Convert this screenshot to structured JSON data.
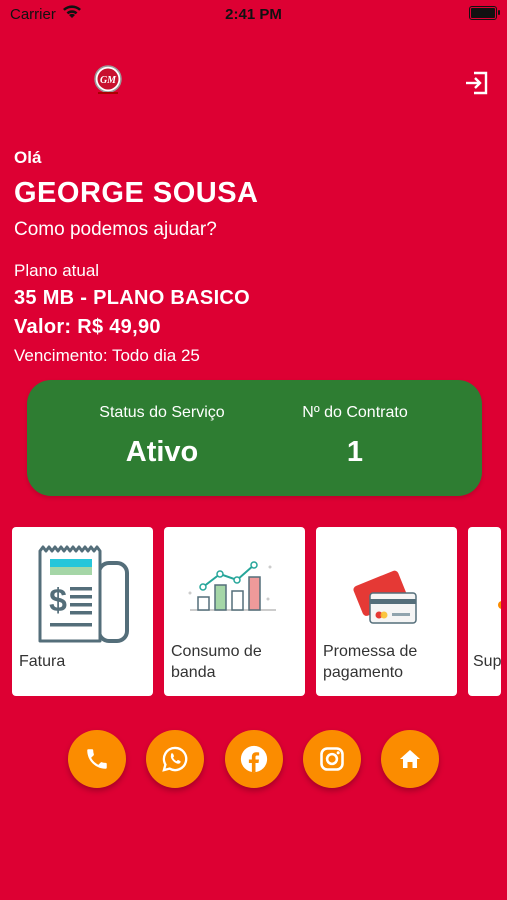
{
  "status_bar": {
    "carrier": "Carrier",
    "time": "2:41 PM"
  },
  "header": {
    "logo_text": "GM",
    "logout_icon": "logout-icon"
  },
  "greeting": {
    "hello": "Olá",
    "name": "GEORGE SOUSA",
    "question": "Como podemos ajudar?"
  },
  "plan": {
    "label": "Plano atual",
    "name": "35 MB - PLANO BASICO",
    "value": "Valor: R$ 49,90",
    "due": "Vencimento: Todo dia 25"
  },
  "status_card": {
    "status_label": "Status do Serviço",
    "status_value": "Ativo",
    "contract_label": "Nº do Contrato",
    "contract_value": "1",
    "color": "#2e7d32"
  },
  "tiles": [
    {
      "label": "Fatura",
      "icon": "invoice-icon"
    },
    {
      "label": "Consumo de banda",
      "icon": "bandwidth-chart-icon"
    },
    {
      "label": "Promessa de pagamento",
      "icon": "credit-card-icon"
    },
    {
      "label": "Sup",
      "icon": "support-icon"
    }
  ],
  "social_buttons": [
    {
      "icon": "phone-icon"
    },
    {
      "icon": "whatsapp-icon"
    },
    {
      "icon": "facebook-icon"
    },
    {
      "icon": "instagram-icon"
    },
    {
      "icon": "home-icon"
    }
  ],
  "colors": {
    "background": "#dd0033",
    "accent": "#fb8c00",
    "card": "#ffffff"
  }
}
